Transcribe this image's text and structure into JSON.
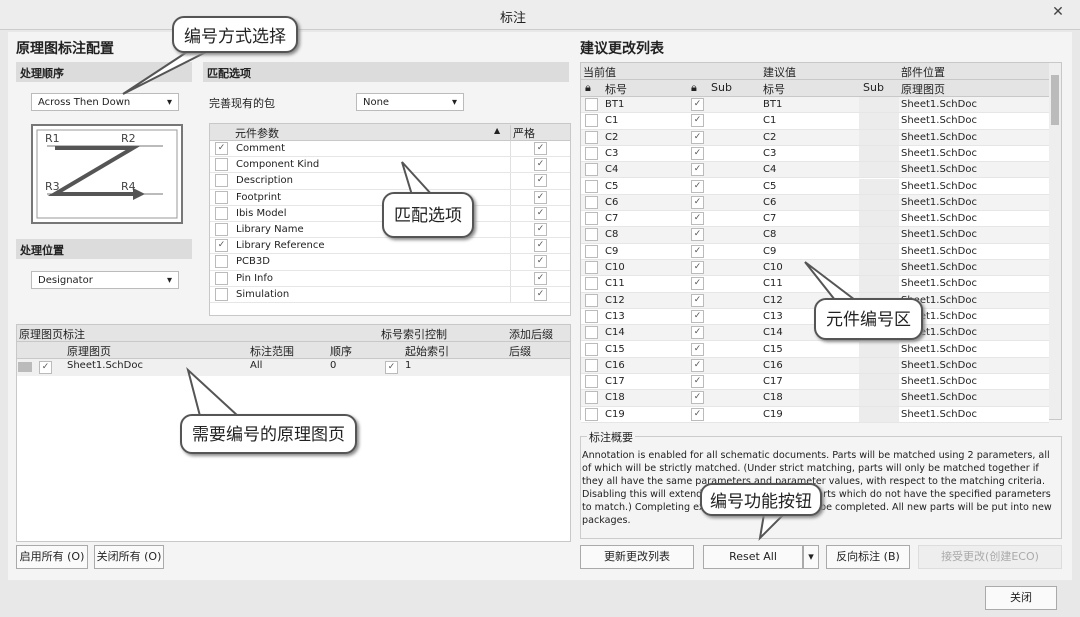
{
  "window": {
    "title": "标注",
    "close_icon": "close-icon"
  },
  "left": {
    "title": "原理图标注配置",
    "order_section": "处理顺序",
    "order_value": "Across Then Down",
    "preview_labels": [
      "R1",
      "R2",
      "R3",
      "R4"
    ],
    "location_section": "处理位置",
    "location_value": "Designator",
    "match_section": "匹配选项",
    "complete_packages_label": "完善现有的包",
    "complete_packages_value": "None",
    "param_header": "元件参数",
    "strict_header": "严格",
    "params": [
      {
        "name": "Comment",
        "checked": true,
        "strict": true
      },
      {
        "name": "Component Kind",
        "checked": false,
        "strict": true
      },
      {
        "name": "Description",
        "checked": false,
        "strict": true
      },
      {
        "name": "Footprint",
        "checked": false,
        "strict": true
      },
      {
        "name": "Ibis Model",
        "checked": false,
        "strict": true
      },
      {
        "name": "Library Name",
        "checked": false,
        "strict": true
      },
      {
        "name": "Library Reference",
        "checked": true,
        "strict": true
      },
      {
        "name": "PCB3D",
        "checked": false,
        "strict": true
      },
      {
        "name": "Pin Info",
        "checked": false,
        "strict": true
      },
      {
        "name": "Simulation",
        "checked": false,
        "strict": true
      }
    ],
    "sheets": {
      "group_header": "原理图页标注",
      "index_group": "标号索引控制",
      "suffix_group": "添加后缀",
      "cols": [
        "原理图页",
        "标注范围",
        "顺序",
        "起始索引",
        "后缀"
      ],
      "rows": [
        {
          "sheet": "Sheet1.SchDoc",
          "scope": "All",
          "order": "0",
          "start": "1",
          "suffix": ""
        }
      ]
    },
    "enable_all": "启用所有 (O)",
    "disable_all": "关闭所有 (O)"
  },
  "right": {
    "title": "建议更改列表",
    "group_current": "当前值",
    "group_proposed": "建议值",
    "group_location": "部件位置",
    "col_designator": "标号",
    "col_sub": "Sub",
    "col_sheet": "原理图页",
    "rows": [
      "BT1",
      "C1",
      "C2",
      "C3",
      "C4",
      "C5",
      "C6",
      "C7",
      "C8",
      "C9",
      "C10",
      "C11",
      "C12",
      "C13",
      "C14",
      "C15",
      "C16",
      "C17",
      "C18",
      "C19"
    ],
    "sheet_name": "Sheet1.SchDoc",
    "summary_title": "标注概要",
    "summary_text": "Annotation is enabled for all schematic documents. Parts will be matched using 2 parameters, all of which will be strictly matched. (Under strict matching, parts will only be matched together if they all have the same parameters and parameter values, with respect to the matching criteria. Disabling this will extend matching by allowing parts which do not have the specified parameters to match.) Completing existing packages will not be completed. All new parts will be put into new packages.",
    "btn_update": "更新更改列表",
    "btn_reset": "Reset All",
    "btn_back": "反向标注 (B)",
    "btn_accept": "接受更改(创建ECO)"
  },
  "close_button": "关闭",
  "callouts": {
    "numbering_method": "编号方式选择",
    "match_options": "匹配选项",
    "designator_area": "元件编号区",
    "sheets": "需要编号的原理图页",
    "buttons": "编号功能按钮"
  }
}
